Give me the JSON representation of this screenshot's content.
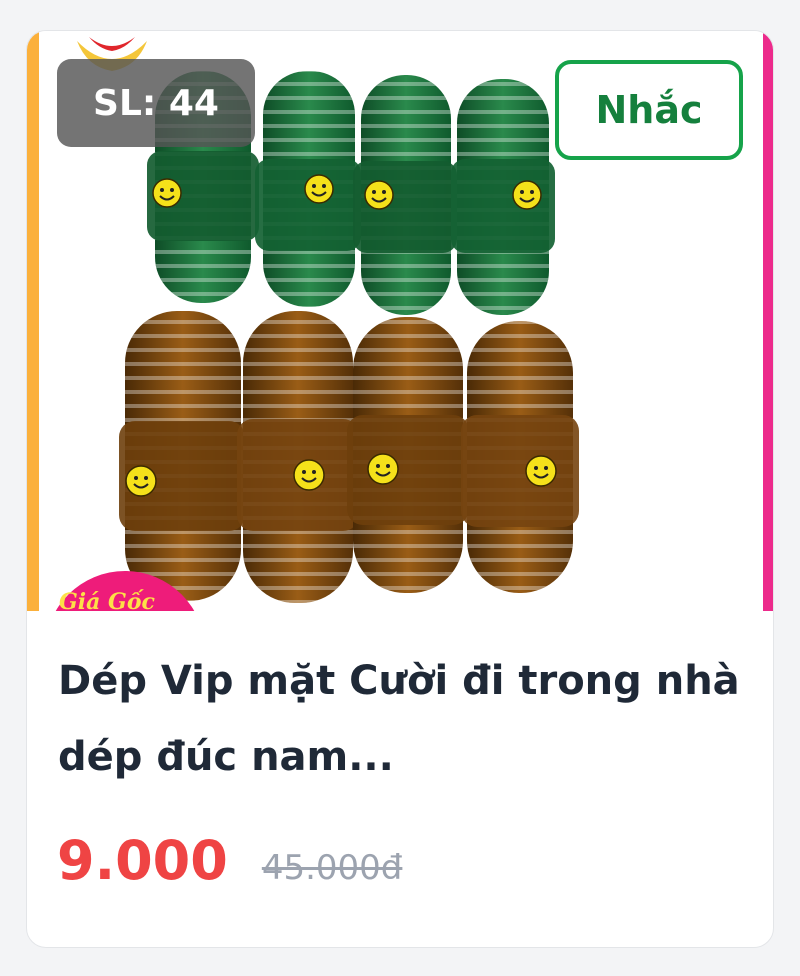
{
  "product": {
    "quantity_badge": "SL: 44",
    "remind_label": "Nhắc",
    "price_tag_label": "Giá Gốc",
    "title": "Dép Vip mặt Cười đi trong nhà dép đúc nam...",
    "price": "9.000",
    "original_price": "45.000đ",
    "image_alt": "Dép nhựa mặt cười xanh lá và nâu",
    "icon": "slipper-product-photo"
  },
  "colors": {
    "accent_green": "#16a34a",
    "price_red": "#ef4444",
    "edge_orange": "#fbb03b",
    "edge_pink": "#ec2a8b",
    "slipper_green": "#1f6b3a",
    "slipper_brown": "#7a4a12",
    "smiley_yellow": "#f5e11a"
  }
}
